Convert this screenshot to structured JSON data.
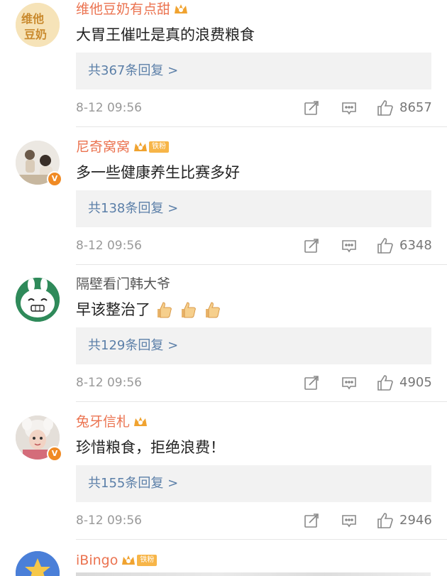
{
  "comments": [
    {
      "user": "维他豆奶有点甜",
      "text": "大胃王催吐是真的浪费粮食",
      "replies": "共367条回复 >",
      "time": "8-12 09:56",
      "likes": "8657",
      "has_fan_badge": false,
      "verified": false
    },
    {
      "user": "尼奇窝窝",
      "text": "多一些健康养生比赛多好",
      "replies": "共138条回复 >",
      "time": "8-12 09:56",
      "likes": "6348",
      "has_fan_badge": true,
      "fan_badge": "铁粉",
      "verified": true
    },
    {
      "user": "隔壁看门韩大爷",
      "text": "早该整治了",
      "replies": "共129条回复 >",
      "time": "8-12 09:56",
      "likes": "4905",
      "has_fan_badge": false,
      "verified": false
    },
    {
      "user": "兔牙信札",
      "text": "珍惜粮食，拒绝浪费！",
      "replies": "共155条回复 >",
      "time": "8-12 09:56",
      "likes": "2946",
      "has_fan_badge": false,
      "verified": true
    },
    {
      "user": "iBingo",
      "fan_badge": "铁粉"
    }
  ],
  "icons": {
    "repost": "repost-icon",
    "comment": "comment-icon",
    "like": "like-icon",
    "crown": "crown-icon",
    "thumbs_up_emoji": "thumbs-up-icon"
  },
  "colors": {
    "username": "#eb7350",
    "reply_link": "#5b7fa8",
    "reply_bg": "#f2f2f2",
    "meta": "#999999",
    "verified": "#f08a24"
  }
}
